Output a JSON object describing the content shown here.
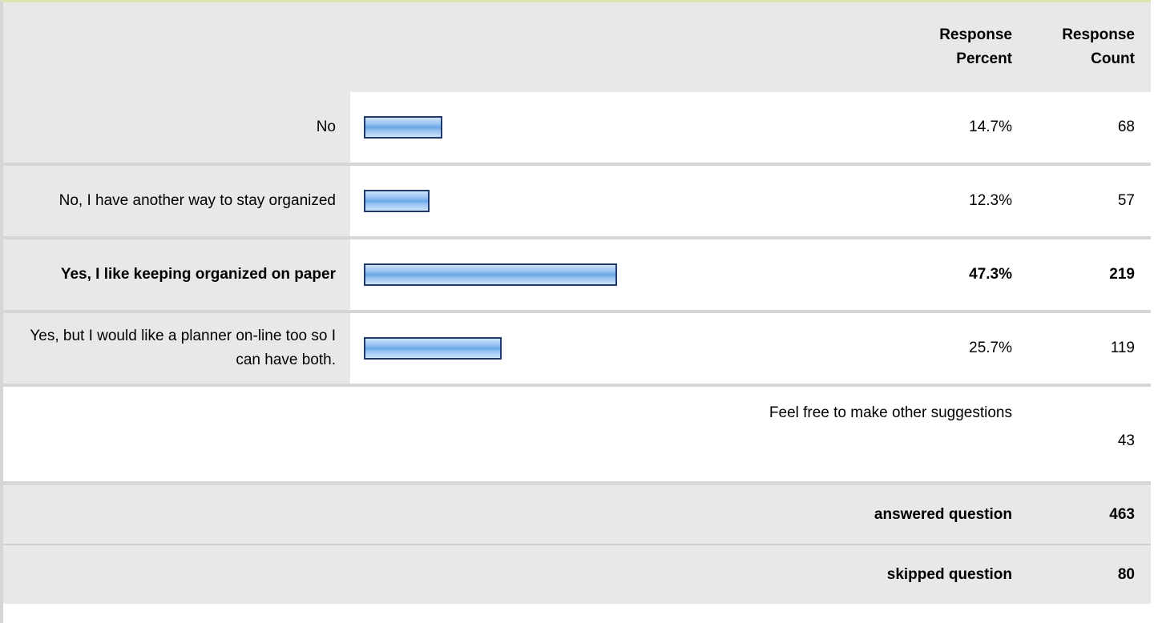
{
  "headers": {
    "response_percent": "Response Percent",
    "response_count": "Response Count"
  },
  "answers": [
    {
      "label": "No",
      "percent": "14.7%",
      "count": "68",
      "fraction": 0.147,
      "bold": false
    },
    {
      "label": "No, I have another way to stay organized",
      "percent": "12.3%",
      "count": "57",
      "fraction": 0.123,
      "bold": false
    },
    {
      "label": "Yes, I like keeping organized on paper",
      "percent": "47.3%",
      "count": "219",
      "fraction": 0.473,
      "bold": true
    },
    {
      "label": "Yes, but I would like a planner on-line too so I can have both.",
      "percent": "25.7%",
      "count": "119",
      "fraction": 0.257,
      "bold": false
    }
  ],
  "other": {
    "text": "Feel free to make other suggestions",
    "count": "43"
  },
  "summary": {
    "answered_label": "answered question",
    "answered_count": "463",
    "skipped_label": "skipped question",
    "skipped_count": "80"
  },
  "colors": {
    "bar_border": "#1f3a6b",
    "bar_fill": "#6aa6e8",
    "label_bg": "#e8e8e8",
    "divider": "#d6d6d6"
  }
}
